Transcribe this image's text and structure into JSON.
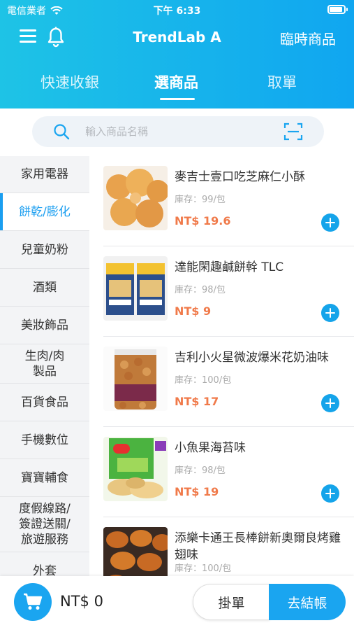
{
  "status_bar": {
    "carrier": "電信業者",
    "time": "下午 6:33",
    "battery_level": 0.9
  },
  "header": {
    "title": "TrendLab A",
    "temp_item_label": "臨時商品"
  },
  "tabs": [
    {
      "label": "快速收銀",
      "active": false
    },
    {
      "label": "選商品",
      "active": true
    },
    {
      "label": "取單",
      "active": false
    }
  ],
  "search": {
    "placeholder": "輸入商品名稱"
  },
  "categories": [
    {
      "label": "家用電器",
      "active": false
    },
    {
      "label": "餅乾/膨化",
      "active": true
    },
    {
      "label": "兒童奶粉",
      "active": false
    },
    {
      "label": "酒類",
      "active": false
    },
    {
      "label": "美妝飾品",
      "active": false
    },
    {
      "label": "生肉/肉\n製品",
      "active": false
    },
    {
      "label": "百貨食品",
      "active": false
    },
    {
      "label": "手機數位",
      "active": false
    },
    {
      "label": "寶寶輔食",
      "active": false
    },
    {
      "label": "度假線路/\n簽證送關/\n旅遊服務",
      "active": false
    },
    {
      "label": "外套",
      "active": false
    }
  ],
  "products": [
    {
      "name": "麥吉士壹口吃芝麻仁小酥",
      "stock": "庫存：99/包",
      "price": "NT$ 19.6"
    },
    {
      "name": "達能閑趣鹹餅幹 TLC",
      "stock": "庫存：98/包",
      "price": "NT$ 9"
    },
    {
      "name": "吉利小火星微波爆米花奶油味",
      "stock": "庫存：100/包",
      "price": "NT$ 17"
    },
    {
      "name": "小魚果海苔味",
      "stock": "庫存：98/包",
      "price": "NT$ 19"
    },
    {
      "name": "添樂卡通王長棒餅新奧爾良烤雞翅味",
      "stock": "庫存：100/包",
      "price": ""
    }
  ],
  "bottom": {
    "cart_total": "NT$ 0",
    "hold_label": "掛單",
    "checkout_label": "去結帳"
  },
  "colors": {
    "accent": "#1aa5f0",
    "header_start": "#1ec3e6",
    "header_end": "#10a6f0",
    "price": "#f07a4a"
  }
}
